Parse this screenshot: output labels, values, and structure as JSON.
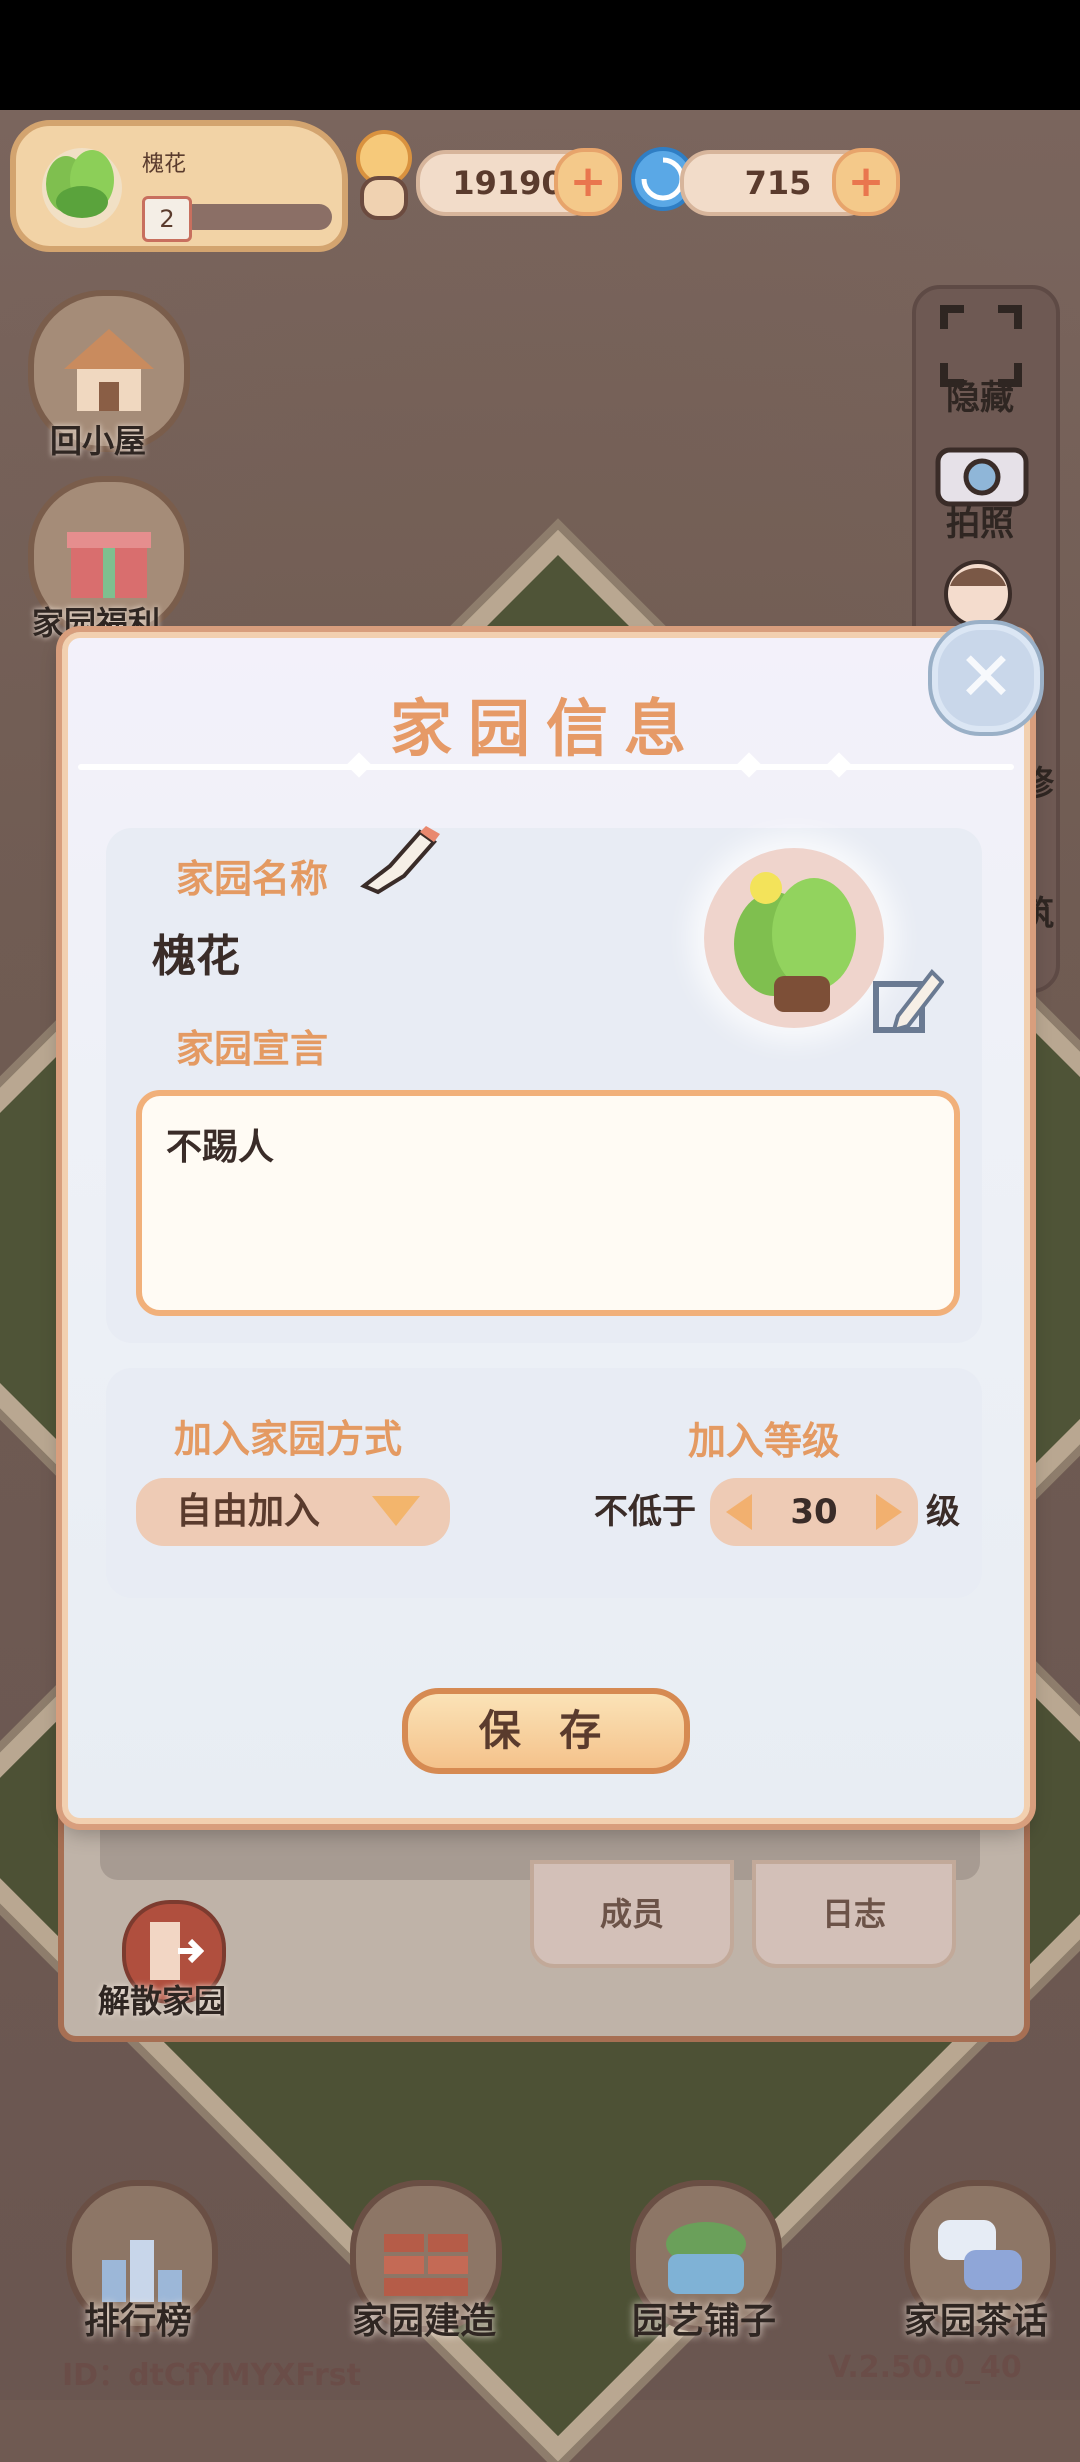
{
  "header": {
    "home_name": "槐花",
    "home_level": "2",
    "snail_coins": "19190",
    "spiral_gems": "715"
  },
  "left_actions": [
    {
      "label": "回小屋"
    },
    {
      "label": "家园福利"
    }
  ],
  "right_actions": [
    {
      "label": "隐藏"
    },
    {
      "label": "拍照"
    },
    {
      "label": "修"
    },
    {
      "label": "筑"
    }
  ],
  "dialog": {
    "title": "家园信息",
    "name_label": "家园名称",
    "name_value": "槐花",
    "declaration_label": "家园宣言",
    "declaration_value": "不踢人",
    "join_method_label": "加入家园方式",
    "join_method_value": "自由加入",
    "join_level_label": "加入等级",
    "join_level_prefix": "不低于",
    "join_level_value": "30",
    "join_level_suffix": "级",
    "save_label": "保 存"
  },
  "under_panel": {
    "tabs": [
      {
        "label": "成员"
      },
      {
        "label": "日志"
      }
    ],
    "dissolve_label": "解散家园"
  },
  "bottom_nav": [
    {
      "label": "排行榜"
    },
    {
      "label": "家园建造"
    },
    {
      "label": "园艺铺子"
    },
    {
      "label": "家园茶话"
    }
  ],
  "footer": {
    "id_text": "ID：dtCfYMYXFrst",
    "version": "V.2.50.0_40"
  },
  "colors": {
    "accent_orange": "#e69a67",
    "button_fill": "#f4c28b",
    "text_dark": "#3a2c28"
  }
}
